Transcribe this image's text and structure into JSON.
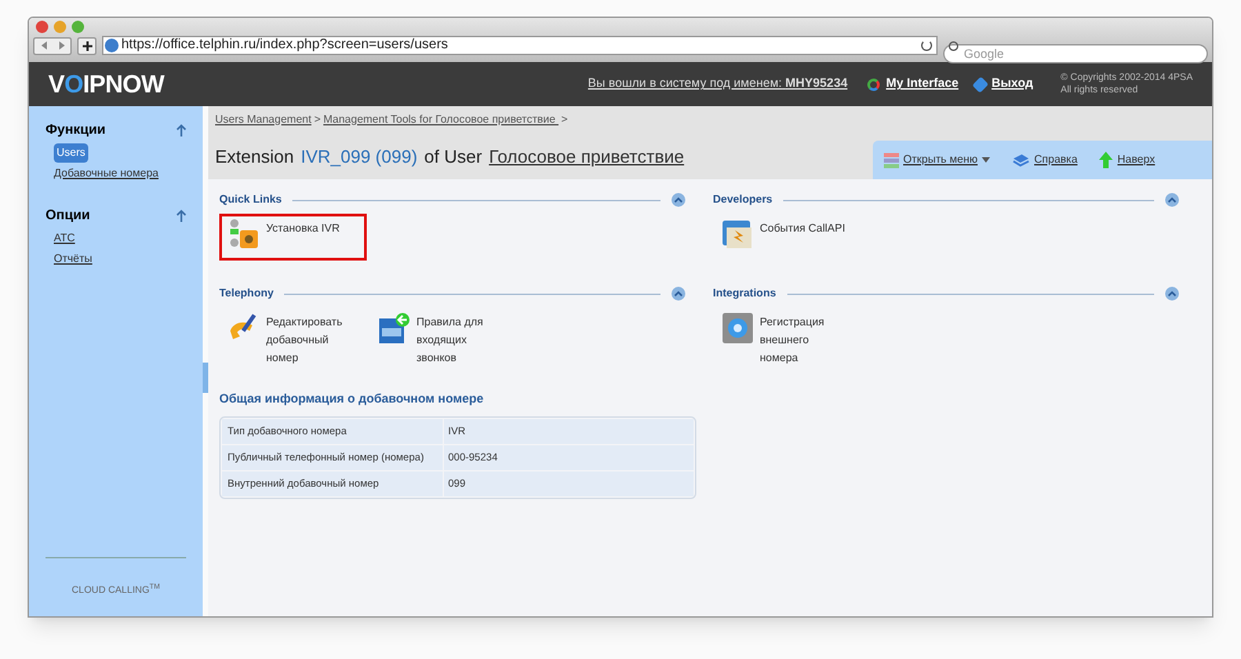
{
  "browser": {
    "url": "https://office.telphin.ru/index.php?screen=users/users",
    "search_placeholder": "Google"
  },
  "header": {
    "logo": {
      "before": "V",
      "accent": "O",
      "after": "IPNOW"
    },
    "login_text": "Вы вошли в систему под именем:",
    "username": "MHY95234",
    "my_interface": "My Interface",
    "logout": "Выход",
    "copyright": [
      "© Copyrights 2002-2014 4PSA",
      "All rights reserved"
    ]
  },
  "sidebar": {
    "sections": [
      {
        "title": "Функции",
        "items": [
          {
            "label": "Users",
            "selected": true
          },
          {
            "label": "Добавочные номера",
            "selected": false
          }
        ]
      },
      {
        "title": "Опции",
        "items": [
          {
            "label": "АТС",
            "selected": false
          },
          {
            "label": "Отчёты",
            "selected": false
          }
        ]
      }
    ],
    "footer": "CLOUD CALLING$^{TM}$"
  },
  "breadcrumb": {
    "items": [
      "Users Management",
      "Management Tools for Голосовое приветствие "
    ],
    "separator": ">"
  },
  "title": {
    "prefix": "Extension",
    "extension": "IVR_099 (099)",
    "middle": "of User",
    "user": "Голосовое приветствие"
  },
  "toolbar": [
    {
      "kind": "menu",
      "label": "Открыть меню"
    },
    {
      "kind": "help",
      "label": "Справка"
    },
    {
      "kind": "top",
      "label": "Наверх"
    }
  ],
  "columns": [
    [
      {
        "title": "Quick Links",
        "items": [
          {
            "kind": "ivr",
            "label": "Установка IVR",
            "highlighted": true
          }
        ]
      },
      {
        "title": "Telephony",
        "items": [
          {
            "kind": "edit",
            "label": "Редактировать добавочный номер",
            "highlighted": false
          },
          {
            "kind": "rules",
            "label": "Правила для входящих звонков",
            "highlighted": false
          }
        ]
      }
    ],
    [
      {
        "title": "Developers",
        "items": [
          {
            "kind": "api",
            "label": "События CallAPI",
            "highlighted": false
          }
        ]
      },
      {
        "title": "Integrations",
        "items": [
          {
            "kind": "register",
            "label": "Регистрация внешнего номера",
            "highlighted": false
          }
        ]
      }
    ]
  ],
  "info": {
    "title": "Общая информация о добавочном номере",
    "rows": [
      {
        "label": "Тип добавочного номера",
        "value": "IVR"
      },
      {
        "label": "Публичный телефонный номер (номера)",
        "value": "000-95234"
      },
      {
        "label": "Внутренний добавочный номер",
        "value": "099"
      }
    ]
  }
}
